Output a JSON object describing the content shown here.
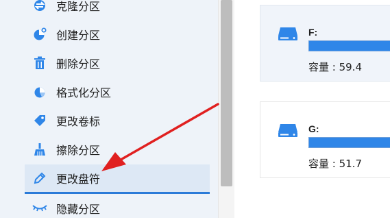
{
  "menu": {
    "items": [
      {
        "label": "克隆分区",
        "icon": "clone-partition-icon"
      },
      {
        "label": "创建分区",
        "icon": "create-partition-icon"
      },
      {
        "label": "删除分区",
        "icon": "trash-icon"
      },
      {
        "label": "格式化分区",
        "icon": "format-pie-icon"
      },
      {
        "label": "更改卷标",
        "icon": "tag-icon"
      },
      {
        "label": "擦除分区",
        "icon": "broom-icon"
      },
      {
        "label": "更改盘符",
        "icon": "pencil-icon",
        "active": true
      },
      {
        "label": "隐藏分区",
        "icon": "hidden-eye-icon"
      }
    ]
  },
  "drives": [
    {
      "letter": "F:",
      "capacity": "容量 : 59.4",
      "usage_fraction": 1.0
    },
    {
      "letter": "G:",
      "capacity": "容量 : 51.7",
      "usage_fraction": 1.0
    }
  ],
  "colors": {
    "accent": "#2b7bd8",
    "icon": "#2f86e8",
    "arrow": "#e02020"
  }
}
